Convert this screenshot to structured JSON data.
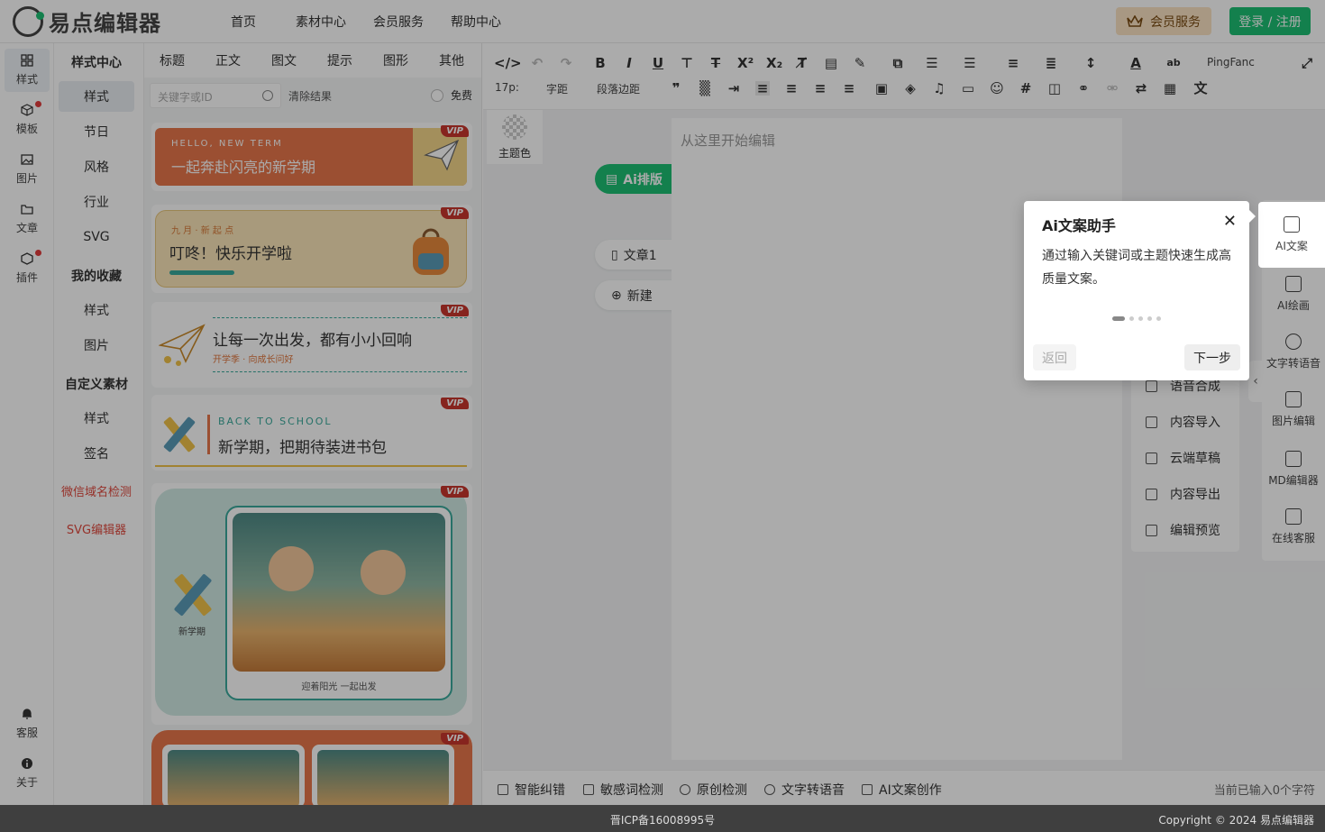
{
  "app": {
    "name": "易点编辑器"
  },
  "nav": [
    "首页",
    "素材中心",
    "会员服务",
    "帮助中心"
  ],
  "header": {
    "vip_label": "会员服务",
    "login_label": "登录 / 注册"
  },
  "rail": [
    {
      "label": "样式",
      "icon": "grid-icon"
    },
    {
      "label": "模板",
      "icon": "cube-icon"
    },
    {
      "label": "图片",
      "icon": "image-icon"
    },
    {
      "label": "文章",
      "icon": "folder-icon"
    },
    {
      "label": "插件",
      "icon": "plugin-icon"
    },
    {
      "label": "客服",
      "icon": "bell-icon"
    },
    {
      "label": "关于",
      "icon": "info-icon"
    }
  ],
  "categories": {
    "style_center": "样式中心",
    "style_items": [
      "样式",
      "节日",
      "风格",
      "行业",
      "SVG"
    ],
    "favorites": "我的收藏",
    "fav_items": [
      "样式",
      "图片"
    ],
    "custom": "自定义素材",
    "custom_items": [
      "样式",
      "签名"
    ],
    "wechat_check": "微信域名检测",
    "svg_editor": "SVG编辑器"
  },
  "material_tabs": [
    "标题",
    "正文",
    "图文",
    "提示",
    "图形",
    "其他"
  ],
  "search": {
    "placeholder": "关键字或ID",
    "clear": "清除结果",
    "free": "免费"
  },
  "cards": {
    "vip": "VIP",
    "c1_small": "HELLO, NEW TERM",
    "c1_title": "一起奔赴闪亮的新学期",
    "c2_small": "九 月 · 新 起 点",
    "c2_title": "叮咚！快乐开学啦",
    "c3_title": "让每一次出发，都有小小回响",
    "c3_sub": "开学季 · 向成长问好",
    "c4_small": "BACK TO SCHOOL",
    "c4_title": "新学期，把期待装进书包",
    "c5_label": "新学期",
    "c5_caption": "迎着阳光 一起出发"
  },
  "toolbar": {
    "font_size": "17p:",
    "letter_spacing": "字距",
    "paragraph_margin": "段落边距",
    "font_family": "PingFanc"
  },
  "editor": {
    "theme_color": "主题色",
    "ai_layout": "Ai排版",
    "doc_tab": "文章1",
    "new_tab": "新建",
    "placeholder": "从这里开始编辑"
  },
  "right_sidebar": [
    "AI文案",
    "AI绘画",
    "文字转语音",
    "图片编辑",
    "MD编辑器",
    "在线客服"
  ],
  "mid_menu": [
    "语音合成",
    "内容导入",
    "云端草稿",
    "内容导出",
    "编辑预览"
  ],
  "statusbar": {
    "items": [
      "智能纠错",
      "敏感词检测",
      "原创检测",
      "文字转语音",
      "AI文案创作"
    ],
    "char_count": "当前已输入0个字符"
  },
  "footer": {
    "icp": "晋ICP备16008995号",
    "copyright": "Copyright © 2024 易点编辑器"
  },
  "popup": {
    "title": "Ai文案助手",
    "close": "✕",
    "body": "通过输入关键词或主题快速生成高质量文案。",
    "back": "返回",
    "next": "下一步",
    "step": 1,
    "total_steps": 5
  },
  "colors": {
    "accent": "#1dbf73",
    "vip_red": "#c8372d",
    "overlay": "rgba(0,0,0,0.33)"
  }
}
